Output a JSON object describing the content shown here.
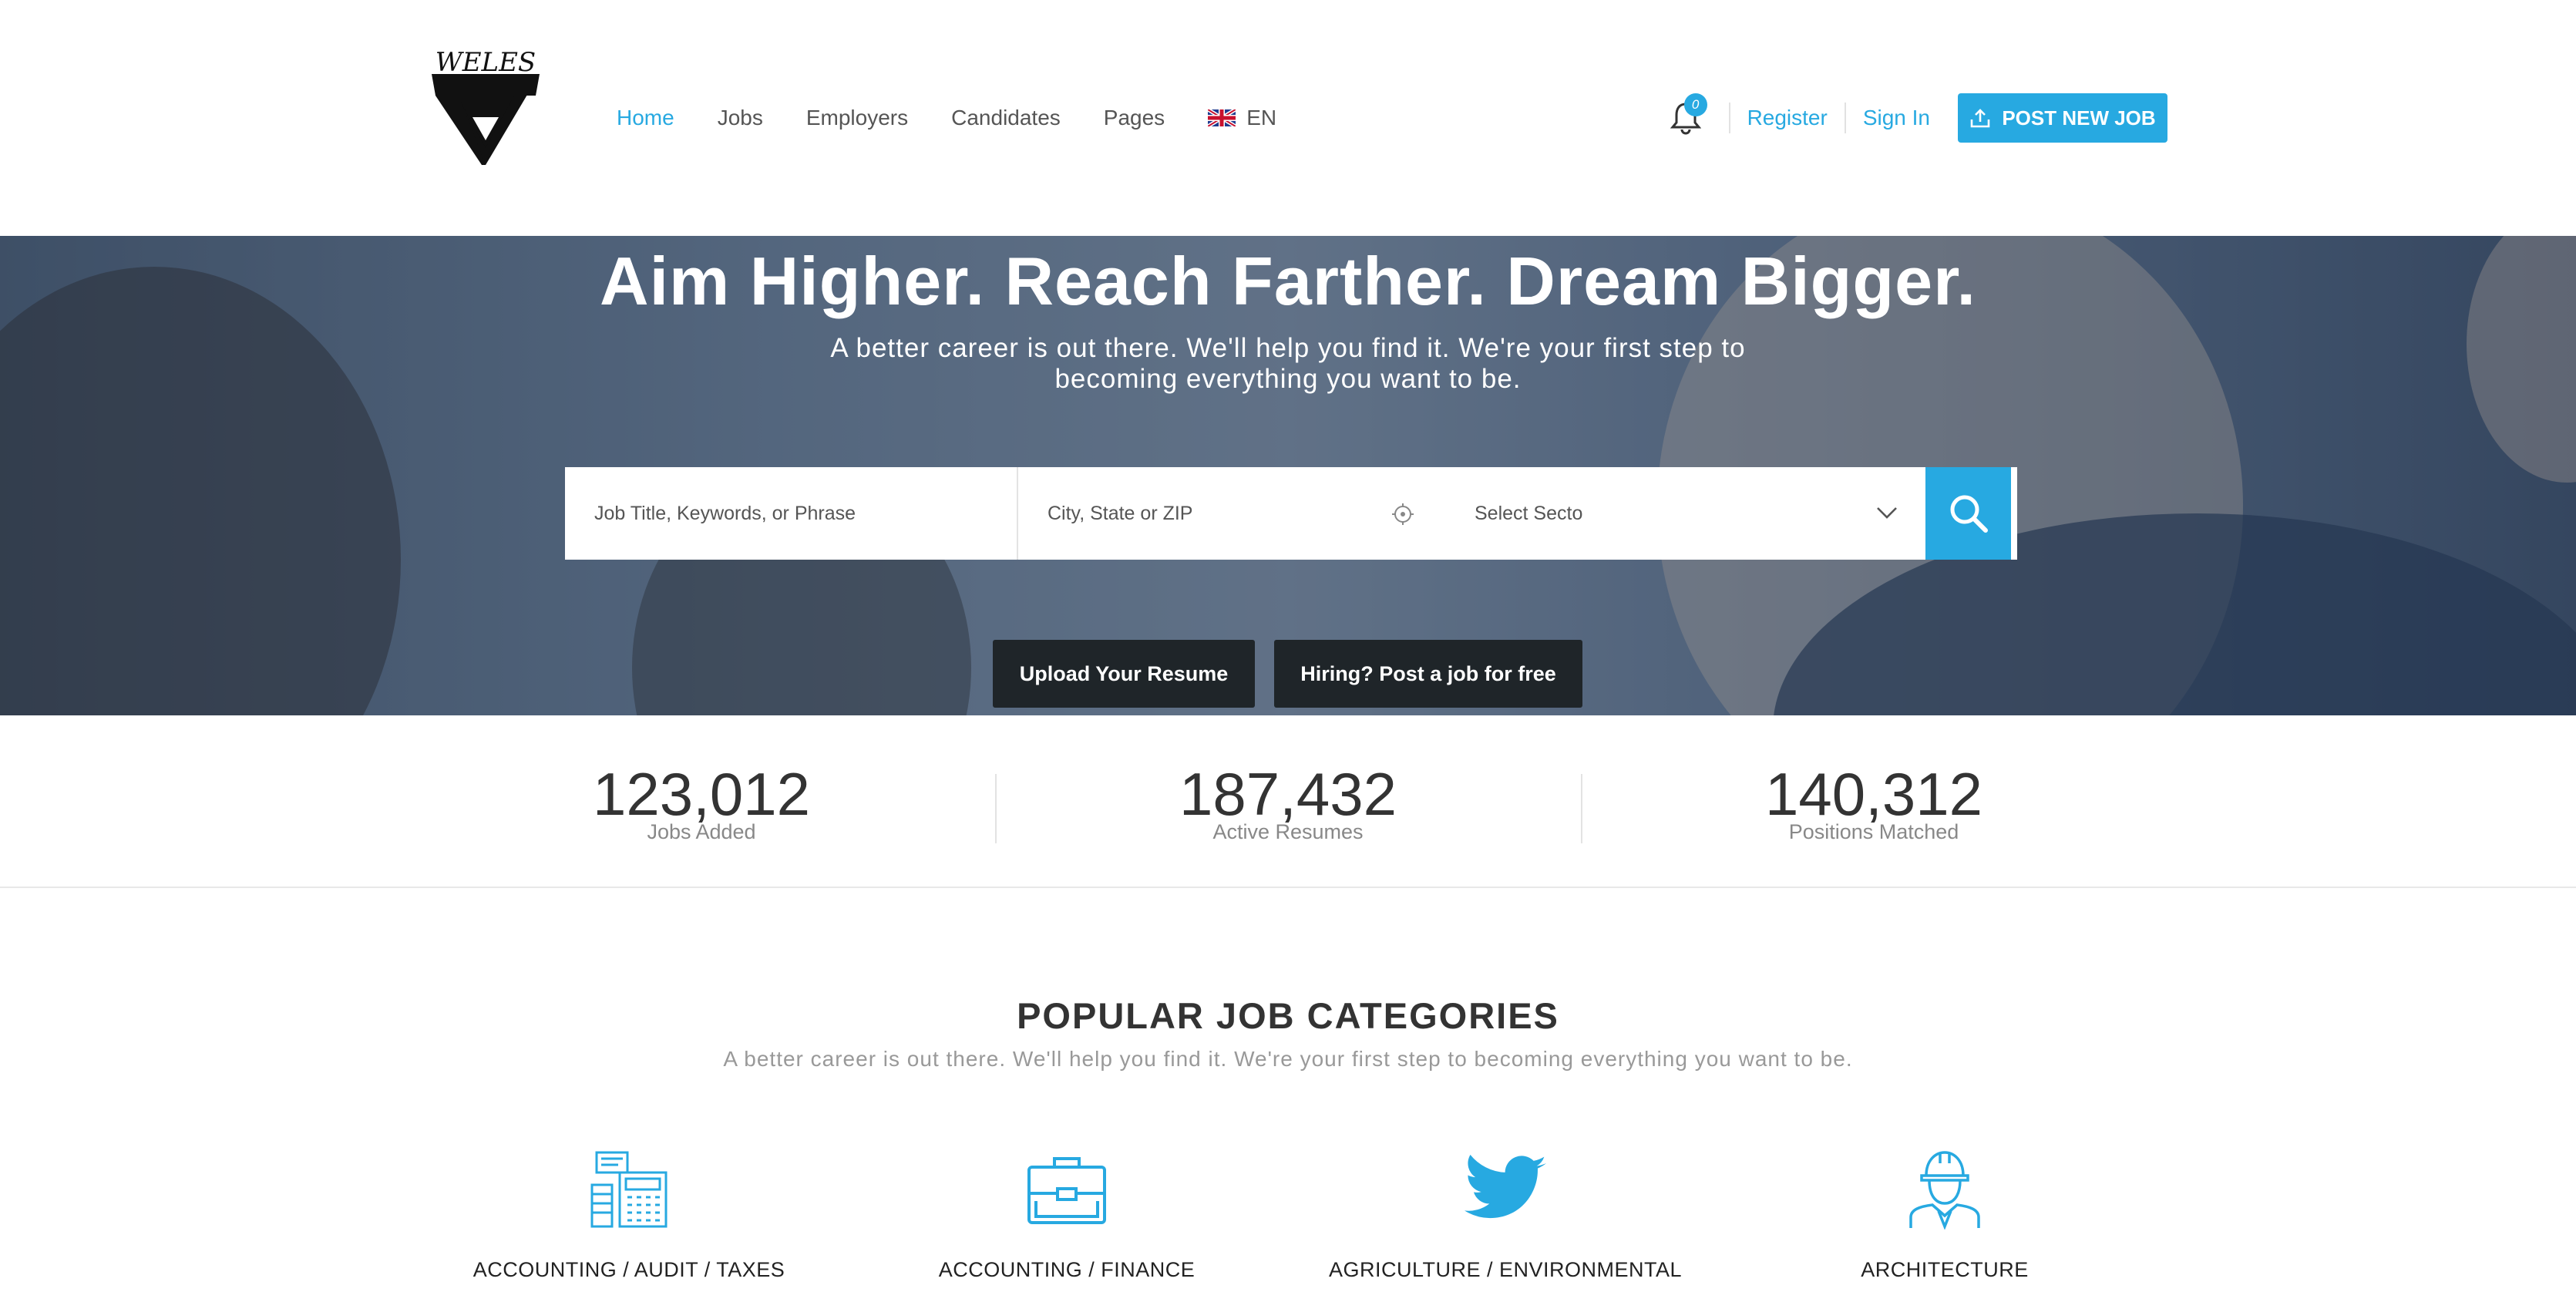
{
  "nav": {
    "items": [
      "Home",
      "Jobs",
      "Employers",
      "Candidates",
      "Pages"
    ],
    "language": "EN",
    "active_color": "#27a9e1"
  },
  "logo": {
    "text": "WELES"
  },
  "header_right": {
    "notification_count": "0",
    "register": "Register",
    "sign_in": "Sign In",
    "post_job": "POST NEW JOB"
  },
  "hero": {
    "title": "Aim Higher. Reach Farther. Dream Bigger.",
    "subtitle": "A better career is out there. We'll help you find it. We're your first step to becoming everything you want to be.",
    "search": {
      "keywords_placeholder": "Job Title, Keywords, or Phrase",
      "location_placeholder": "City, State or ZIP",
      "sector_selected": "Select Secto"
    },
    "buttons": {
      "upload": "Upload Your Resume",
      "hiring": "Hiring? Post a job for free"
    }
  },
  "stats": [
    {
      "value": "123,012",
      "label": "Jobs Added"
    },
    {
      "value": "187,432",
      "label": "Active Resumes"
    },
    {
      "value": "140,312",
      "label": "Positions Matched"
    }
  ],
  "categories": {
    "title": "POPULAR JOB CATEGORIES",
    "subtitle": "A better career is out there. We'll help you find it. We're your first step to becoming everything you want to be.",
    "items": [
      {
        "name": "ACCOUNTING / AUDIT / TAXES",
        "icon": "calculator-icon"
      },
      {
        "name": "ACCOUNTING / FINANCE",
        "icon": "briefcase-icon"
      },
      {
        "name": "AGRICULTURE / ENVIRONMENTAL",
        "icon": "twitter-bird-icon"
      },
      {
        "name": "ARCHITECTURE",
        "icon": "worker-helmet-icon"
      }
    ]
  },
  "colors": {
    "accent": "#27a9e1",
    "dark_button": "#1f2529"
  }
}
